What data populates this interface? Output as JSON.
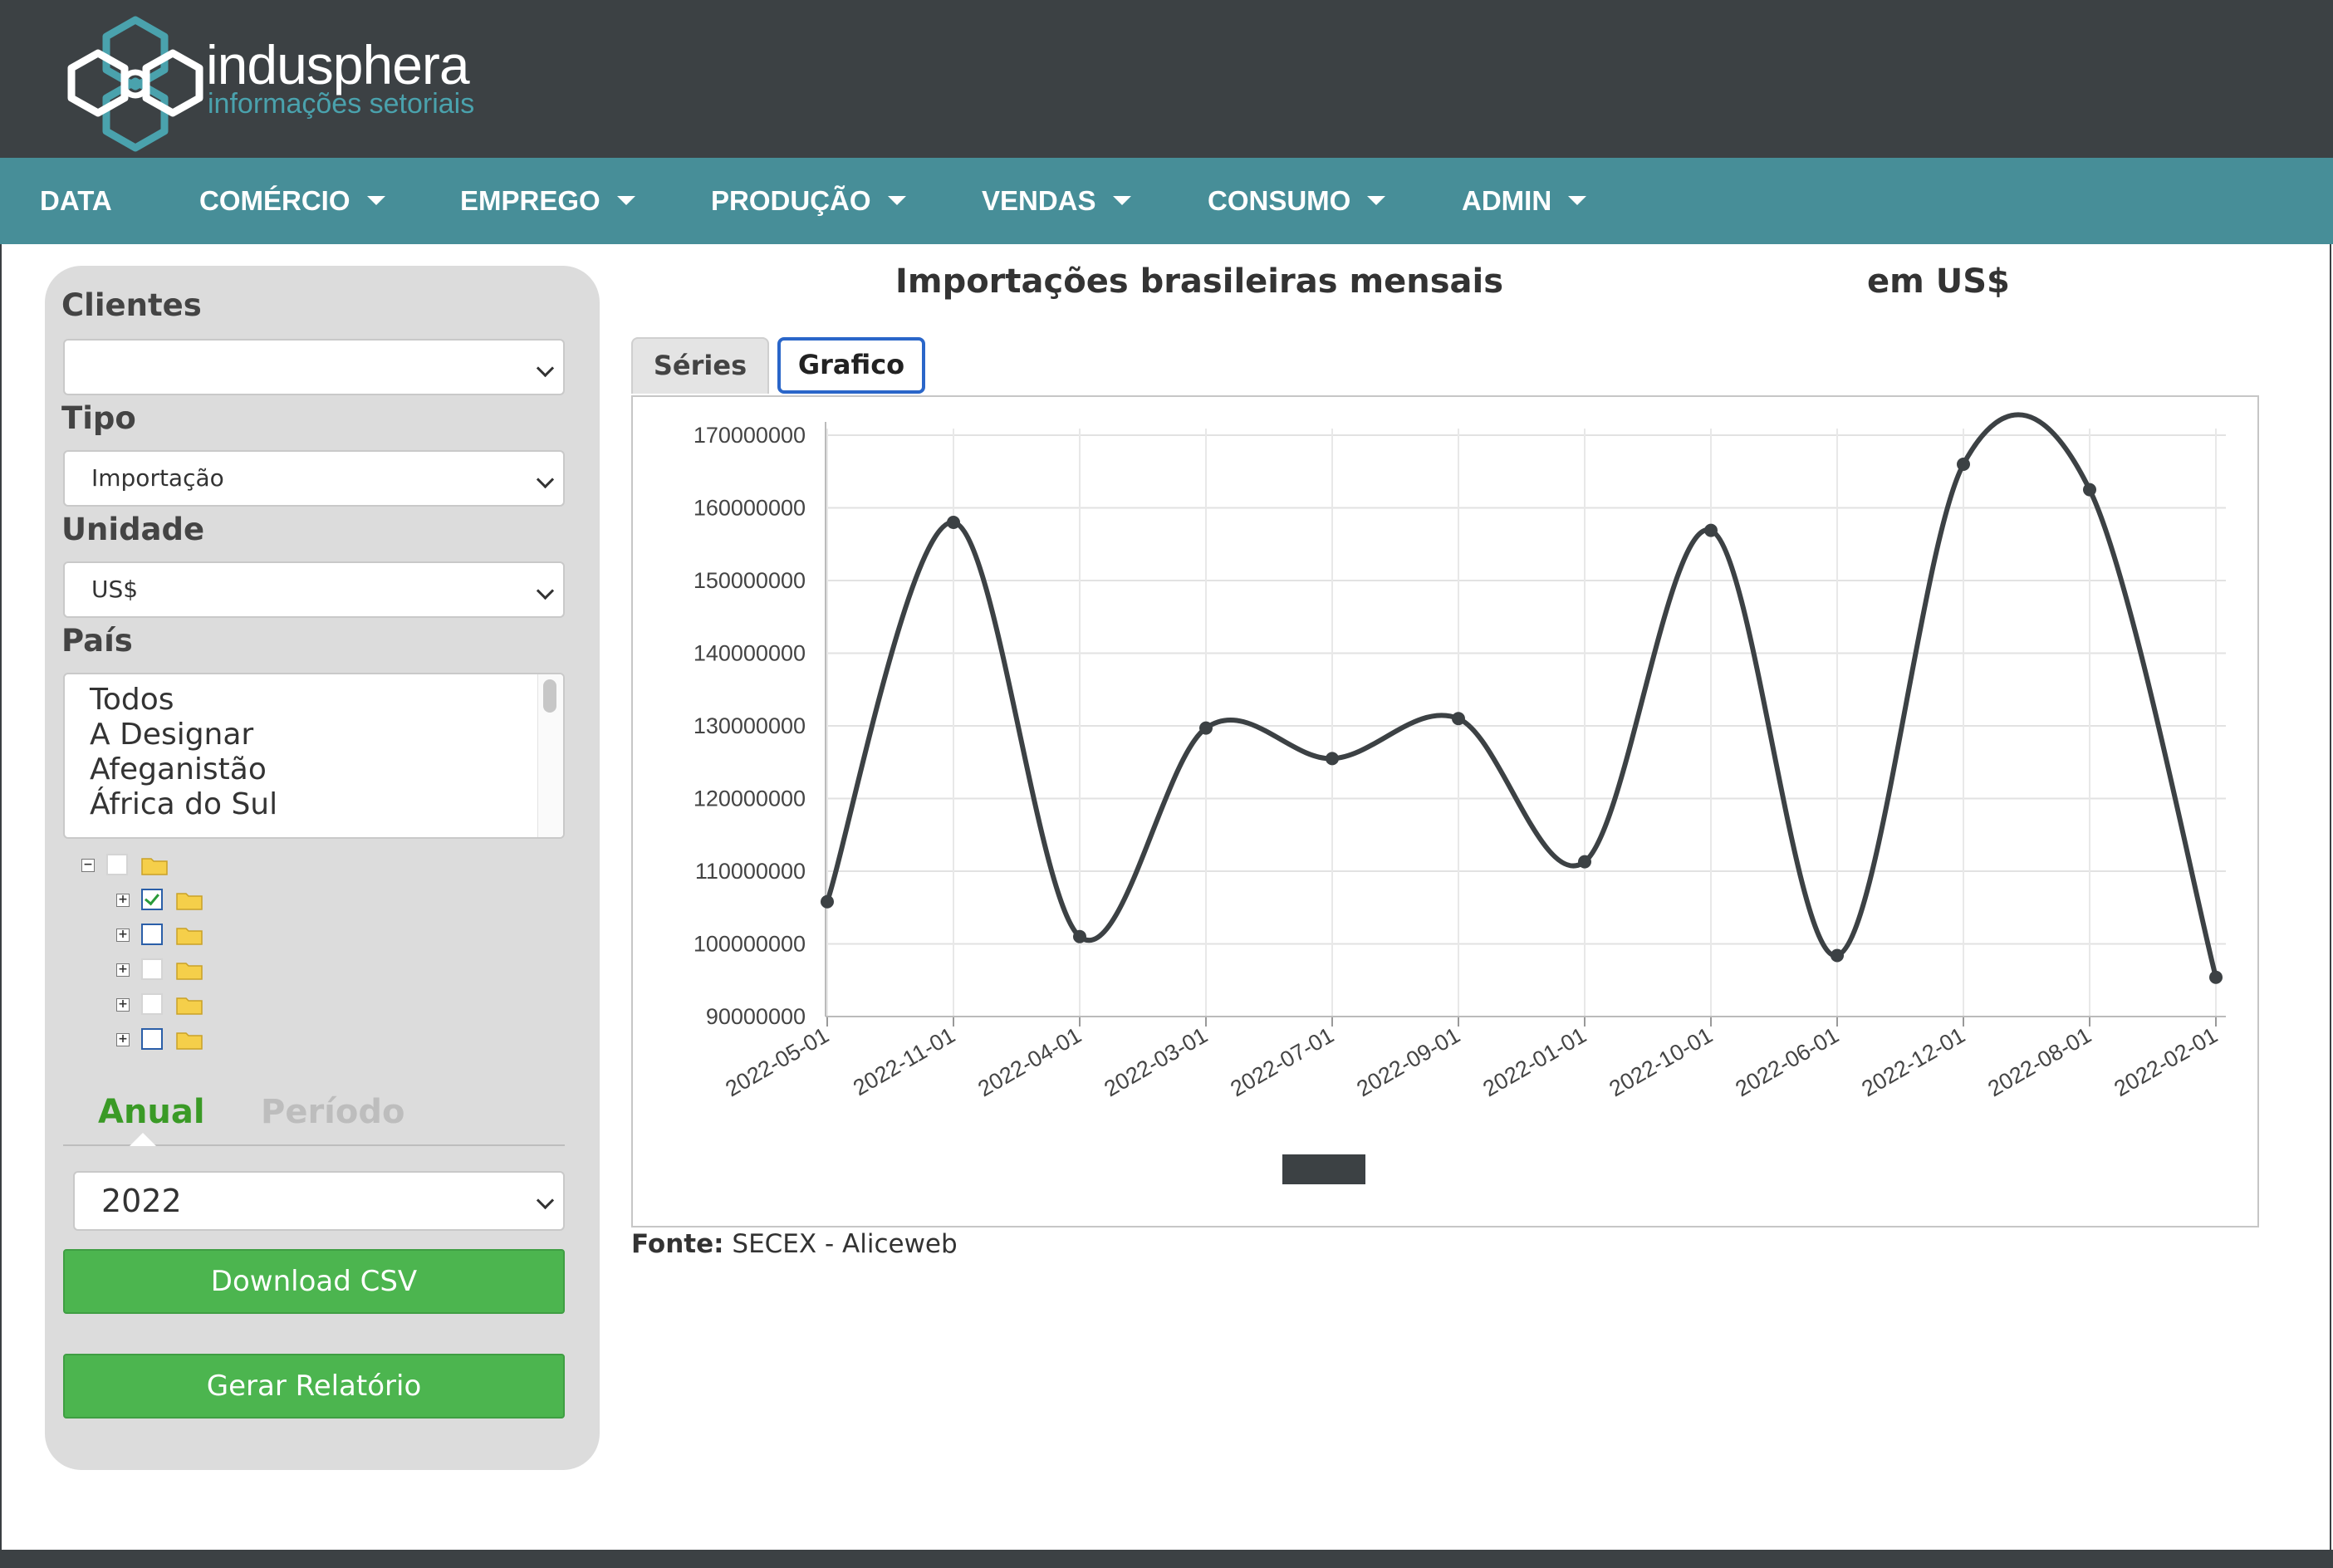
{
  "brand": {
    "name": "indusphera",
    "tagline": "informações setoriais"
  },
  "nav": {
    "items": [
      {
        "label": "DATA",
        "dropdown": false
      },
      {
        "label": "COMÉRCIO",
        "dropdown": true
      },
      {
        "label": "EMPREGO",
        "dropdown": true
      },
      {
        "label": "PRODUÇÃO",
        "dropdown": true
      },
      {
        "label": "VENDAS",
        "dropdown": true
      },
      {
        "label": "CONSUMO",
        "dropdown": true
      },
      {
        "label": "ADMIN",
        "dropdown": true
      }
    ]
  },
  "sidebar": {
    "clientes_label": "Clientes",
    "clientes_value": "",
    "tipo_label": "Tipo",
    "tipo_value": "Importação",
    "unidade_label": "Unidade",
    "unidade_value": "US$",
    "pais_label": "País",
    "countries": [
      "Todos",
      "A Designar",
      "Afeganistão",
      "África do Sul"
    ],
    "tree": [
      {
        "level": 0,
        "toggle": "minus",
        "checkbox": "gray"
      },
      {
        "level": 1,
        "toggle": "plus",
        "checkbox": "checked"
      },
      {
        "level": 1,
        "toggle": "plus",
        "checkbox": "empty"
      },
      {
        "level": 1,
        "toggle": "plus",
        "checkbox": "gray"
      },
      {
        "level": 1,
        "toggle": "plus",
        "checkbox": "gray"
      },
      {
        "level": 1,
        "toggle": "plus",
        "checkbox": "empty"
      }
    ],
    "period_tabs": {
      "anual": "Anual",
      "periodo": "Período",
      "active": "anual"
    },
    "year_value": "2022",
    "download_csv": "Download CSV",
    "gerar_relatorio": "Gerar Relatório"
  },
  "main": {
    "title": "Importações brasileiras mensais",
    "unit": "em US$",
    "tabs": {
      "series": "Séries",
      "grafico": "Grafico",
      "active": "grafico"
    },
    "source_label": "Fonte:",
    "source_value": "SECEX - Aliceweb"
  },
  "colors": {
    "header": "#3c4144",
    "nav": "#478e98",
    "accent_green": "#4cb54f",
    "line": "#3c4144"
  },
  "chart_data": {
    "type": "line",
    "title": "",
    "xlabel": "",
    "ylabel": "",
    "x": [
      "2022-05-01",
      "2022-11-01",
      "2022-04-01",
      "2022-03-01",
      "2022-07-01",
      "2022-09-01",
      "2022-01-01",
      "2022-10-01",
      "2022-06-01",
      "2022-12-01",
      "2022-08-01",
      "2022-02-01"
    ],
    "series": [
      {
        "values": [
          105800000,
          158000000,
          101000000,
          129700000,
          125500000,
          131000000,
          111300000,
          156900000,
          98400000,
          166000000,
          162500000,
          95400000
        ]
      }
    ],
    "yticks": [
      90000000,
      100000000,
      110000000,
      120000000,
      130000000,
      140000000,
      150000000,
      160000000,
      170000000
    ],
    "ylim": [
      90000000,
      170000000
    ],
    "smooth": true,
    "grid": true,
    "legend": "none"
  }
}
